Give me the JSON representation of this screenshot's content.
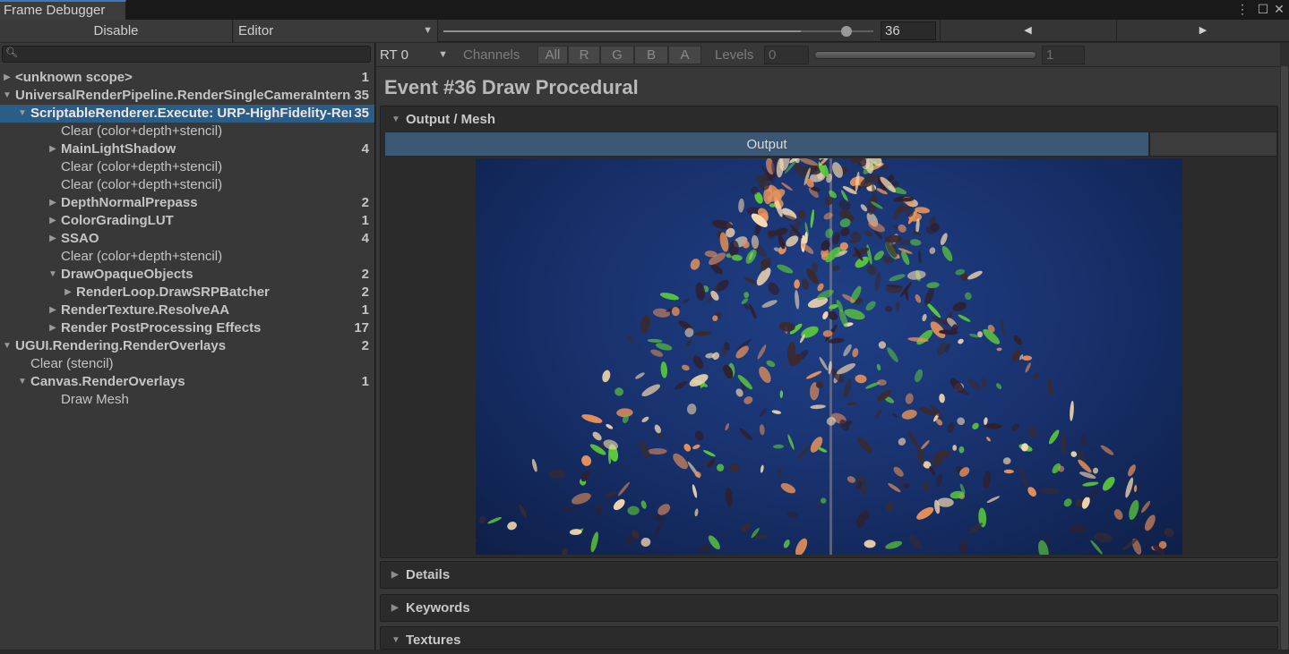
{
  "window": {
    "tab_title": "Frame Debugger",
    "menu_icon": "kebab-menu-icon",
    "maximize_icon": "maximize-icon",
    "close_icon": "close-icon"
  },
  "toolbar": {
    "disable_label": "Disable",
    "target_label": "Editor",
    "event_index": "36",
    "event_slider_fraction": 0.906
  },
  "tree": {
    "rows": [
      {
        "label": "<unknown scope>",
        "count": "1",
        "arrow": "▶",
        "bold": true
      },
      {
        "label": "UniversalRenderPipeline.RenderSingleCameraInternal",
        "count": "35",
        "arrow": "▼",
        "bold": true
      },
      {
        "label": "ScriptableRenderer.Execute: URP-HighFidelity-Renderer",
        "count": "35",
        "arrow": "▼",
        "bold": true,
        "selected": true
      },
      {
        "label": "Clear (color+depth+stencil)",
        "count": "",
        "arrow": "",
        "bold": false
      },
      {
        "label": "MainLightShadow",
        "count": "4",
        "arrow": "▶",
        "bold": true
      },
      {
        "label": "Clear (color+depth+stencil)",
        "count": "",
        "arrow": "",
        "bold": false
      },
      {
        "label": "Clear (color+depth+stencil)",
        "count": "",
        "arrow": "",
        "bold": false
      },
      {
        "label": "DepthNormalPrepass",
        "count": "2",
        "arrow": "▶",
        "bold": true
      },
      {
        "label": "ColorGradingLUT",
        "count": "1",
        "arrow": "▶",
        "bold": true
      },
      {
        "label": "SSAO",
        "count": "4",
        "arrow": "▶",
        "bold": true
      },
      {
        "label": "Clear (color+depth+stencil)",
        "count": "",
        "arrow": "",
        "bold": false
      },
      {
        "label": "DrawOpaqueObjects",
        "count": "2",
        "arrow": "▼",
        "bold": true
      },
      {
        "label": "RenderLoop.DrawSRPBatcher",
        "count": "2",
        "arrow": "▶",
        "bold": true
      },
      {
        "label": "RenderTexture.ResolveAA",
        "count": "1",
        "arrow": "▶",
        "bold": true
      },
      {
        "label": "Render PostProcessing Effects",
        "count": "17",
        "arrow": "▶",
        "bold": true
      },
      {
        "label": "UGUI.Rendering.RenderOverlays",
        "count": "2",
        "arrow": "▼",
        "bold": true
      },
      {
        "label": "Clear (stencil)",
        "count": "",
        "arrow": "",
        "bold": false
      },
      {
        "label": "Canvas.RenderOverlays",
        "count": "1",
        "arrow": "▼",
        "bold": true
      },
      {
        "label": "Draw Mesh",
        "count": "",
        "arrow": "",
        "bold": false
      }
    ]
  },
  "render_target": {
    "rt_label": "RT 0",
    "channels_label": "Channels",
    "channels": [
      "All",
      "R",
      "G",
      "B",
      "A"
    ],
    "levels_label": "Levels",
    "levels_min": "0",
    "levels_max": "1"
  },
  "event": {
    "title": "Event #36 Draw Procedural"
  },
  "sections": {
    "output_mesh": "Output / Mesh",
    "output_tab": "Output",
    "details": "Details",
    "keywords": "Keywords",
    "textures": "Textures"
  },
  "colors": {
    "selection": "#2c5d87",
    "preview_background": "#193370",
    "creature_orange": "#e8925a",
    "creature_green": "#5cc93c"
  }
}
